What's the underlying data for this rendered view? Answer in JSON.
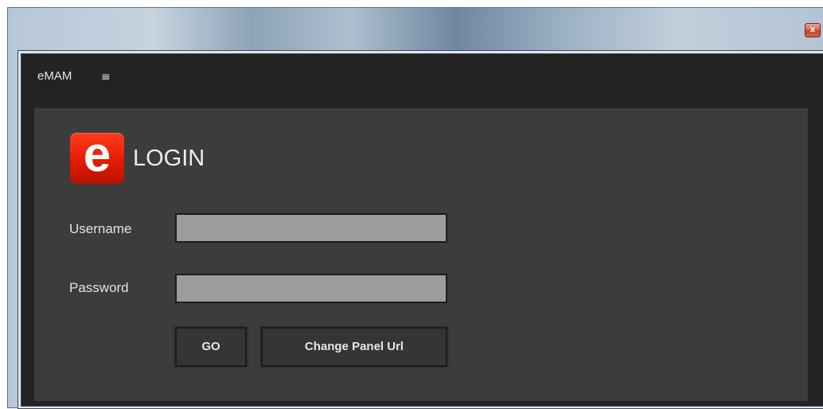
{
  "window": {
    "close_label": "x"
  },
  "app": {
    "name": "eMAM",
    "menu_icon": "hamburger-icon",
    "menu_glyph": "≡"
  },
  "login": {
    "logo_letter": "e",
    "title": "LOGIN",
    "username_label": "Username",
    "username_value": "",
    "password_label": "Password",
    "password_value": "",
    "go_label": "GO",
    "change_url_label": "Change Panel Url"
  },
  "colors": {
    "logo_red": "#e41c05",
    "panel_bg": "#3c3c3c",
    "app_bg": "#232323",
    "input_bg": "#9c9c9c"
  }
}
